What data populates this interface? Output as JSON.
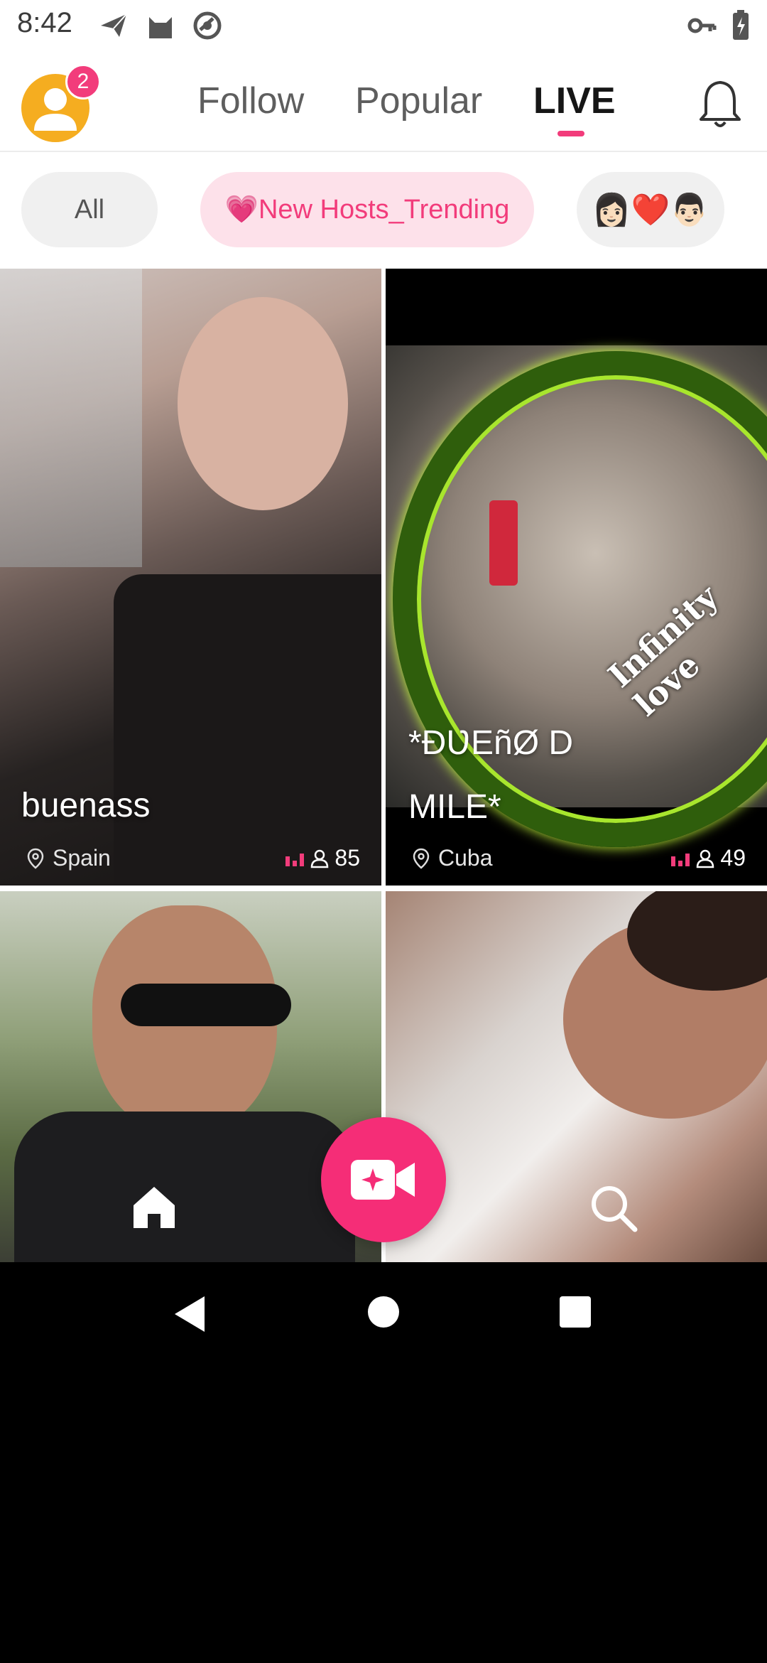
{
  "status_bar": {
    "time": "8:42",
    "left_icons": [
      "send-icon",
      "cat-icon",
      "sync-icon"
    ],
    "right_icons": [
      "key-icon",
      "battery-icon"
    ]
  },
  "header": {
    "notification_count": "2",
    "tabs": [
      {
        "label": "Follow",
        "active": false
      },
      {
        "label": "Popular",
        "active": false
      },
      {
        "label": "LIVE",
        "active": true
      }
    ],
    "accent_color": "#f23c7b"
  },
  "filters": {
    "all_label": "All",
    "trending_label": "💗New Hosts_Trending",
    "couple_label": "👩🏻❤️👨🏻"
  },
  "streams": [
    {
      "name": "buenass",
      "country": "Spain",
      "viewers": "85"
    },
    {
      "name_line1": "*ĐƲEñØ D",
      "name_line2": "MILE*",
      "country": "Cuba",
      "viewers": "49",
      "overlay_text": "Infinity love"
    },
    {},
    {}
  ],
  "bottom_nav": {
    "home": "home-icon",
    "go_live": "live-camera-icon",
    "search": "search-icon"
  }
}
